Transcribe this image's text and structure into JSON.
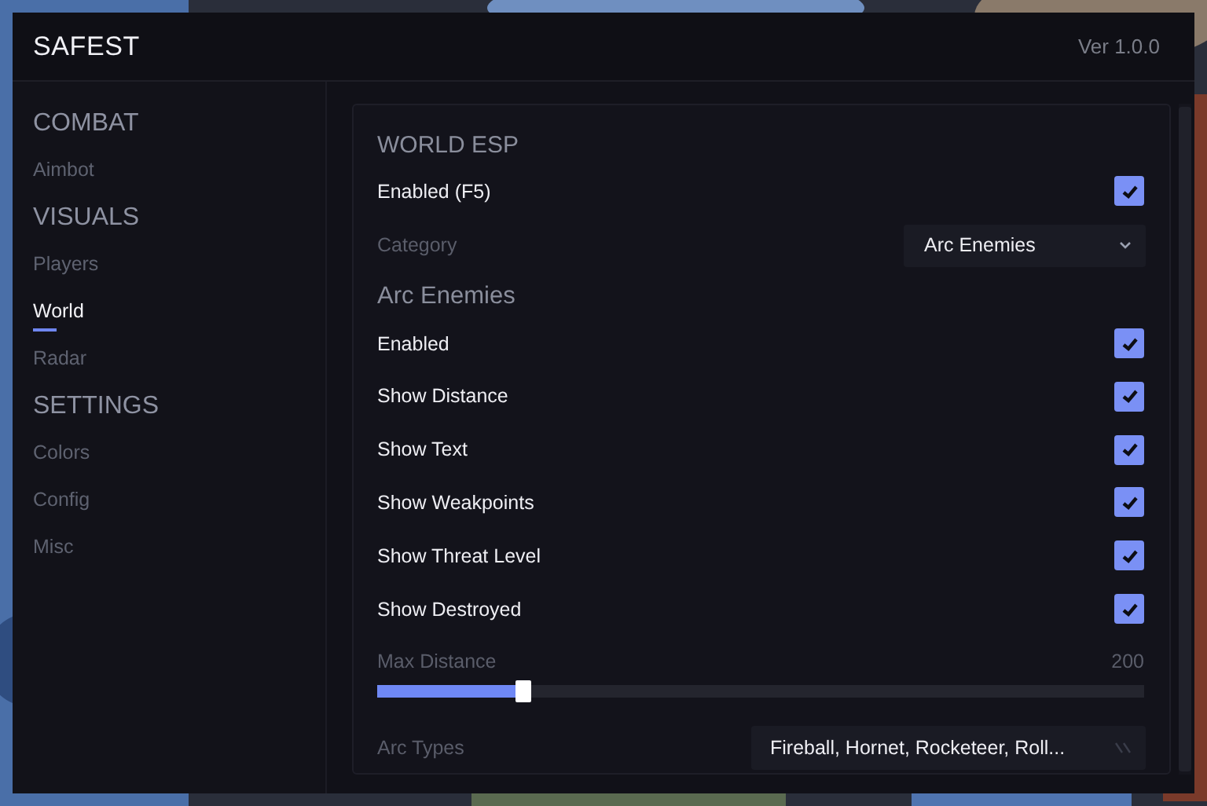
{
  "window": {
    "title": "SAFEST",
    "version": "Ver 1.0.0"
  },
  "sidebar": {
    "sections": [
      {
        "heading": "COMBAT",
        "items": [
          {
            "label": "Aimbot",
            "selected": false
          }
        ]
      },
      {
        "heading": "VISUALS",
        "items": [
          {
            "label": "Players",
            "selected": false
          },
          {
            "label": "World",
            "selected": true
          },
          {
            "label": "Radar",
            "selected": false
          }
        ]
      },
      {
        "heading": "SETTINGS",
        "items": [
          {
            "label": "Colors",
            "selected": false
          },
          {
            "label": "Config",
            "selected": false
          },
          {
            "label": "Misc",
            "selected": false
          }
        ]
      }
    ]
  },
  "panel": {
    "title": "WORLD ESP",
    "rows": [
      {
        "kind": "checkbox",
        "label": "Enabled (F5)",
        "checked": true
      },
      {
        "kind": "dropdown",
        "label": "Category",
        "value": "Arc Enemies"
      },
      {
        "kind": "heading",
        "label": "Arc Enemies"
      },
      {
        "kind": "checkbox",
        "label": "Enabled",
        "checked": true
      },
      {
        "kind": "checkbox",
        "label": "Show Distance",
        "checked": true
      },
      {
        "kind": "checkbox",
        "label": "Show Text",
        "checked": true
      },
      {
        "kind": "checkbox",
        "label": "Show Weakpoints",
        "checked": true
      },
      {
        "kind": "checkbox",
        "label": "Show Threat Level",
        "checked": true
      },
      {
        "kind": "checkbox",
        "label": "Show Destroyed",
        "checked": true
      },
      {
        "kind": "slider",
        "label": "Max Distance",
        "reading": "200",
        "level": 0.19
      },
      {
        "kind": "multiselect",
        "label": "Arc Types",
        "value": "Fireball, Hornet, Rocketeer, Roll..."
      }
    ]
  }
}
